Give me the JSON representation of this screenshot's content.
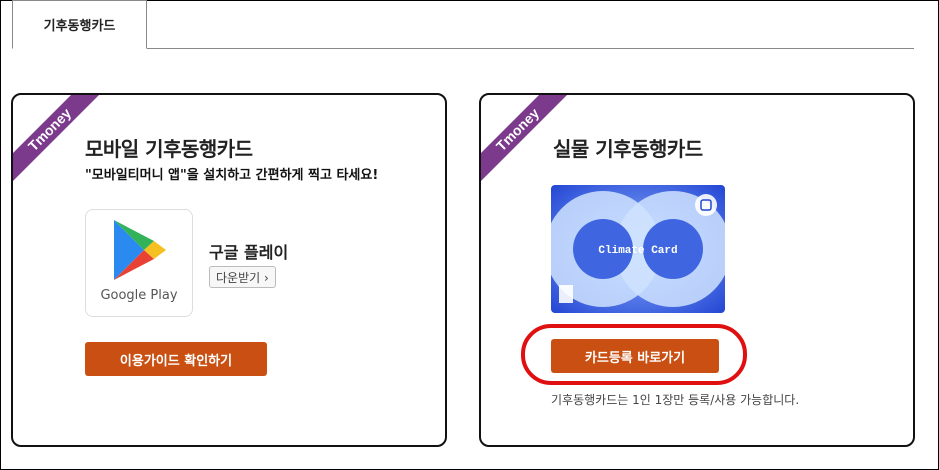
{
  "tabs": [
    {
      "label": "기후동행카드"
    }
  ],
  "mobile_card": {
    "badge": "Tmoney",
    "title": "모바일 기후동행카드",
    "subtitle": "\"모바일티머니 앱\"을 설치하고 간편하게 찍고 타세요!",
    "store_logo_label": "Google Play",
    "store_name": "구글 플레이",
    "download_label": "다운받기 ›",
    "guide_button": "이용가이드 확인하기"
  },
  "physical_card": {
    "badge": "Tmoney",
    "title": "실물 기후동행카드",
    "card_image_text": "Climate Card",
    "register_button": "카드등록 바로가기",
    "note": "기후동행카드는 1인 1장만 등록/사용 가능합니다."
  },
  "colors": {
    "accent_button": "#c95012",
    "ribbon": "#7b3a8c",
    "highlight": "#e01010",
    "card_blue": "#2a4fd6"
  }
}
